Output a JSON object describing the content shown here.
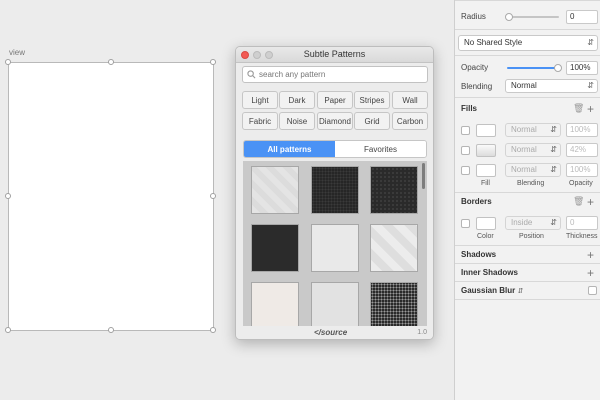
{
  "artboard": {
    "label": "view"
  },
  "plugin": {
    "title": "Subtle Patterns",
    "search_placeholder": "search any pattern",
    "chips": [
      "Light",
      "Dark",
      "Paper",
      "Stripes",
      "Wall",
      "Fabric",
      "Noise",
      "Diamond",
      "Grid",
      "Carbon"
    ],
    "tabs": {
      "all": "All patterns",
      "favorites": "Favorites"
    },
    "footer_logo": "source",
    "version": "1.0"
  },
  "inspector": {
    "radius": {
      "label": "Radius",
      "value": "0"
    },
    "shared_style": "No Shared Style",
    "opacity": {
      "label": "Opacity",
      "value": "100%",
      "level": 1.0
    },
    "blending": {
      "label": "Blending",
      "value": "Normal"
    },
    "fills": {
      "title": "Fills",
      "rows": [
        {
          "blend": "Normal",
          "opacity": "100%"
        },
        {
          "blend": "Normal",
          "opacity": "42%"
        },
        {
          "blend": "Normal",
          "opacity": "100%"
        }
      ],
      "col_fill": "Fill",
      "col_blending": "Blending",
      "col_opacity": "Opacity"
    },
    "borders": {
      "title": "Borders",
      "position": "Inside",
      "thickness": "0",
      "col_color": "Color",
      "col_position": "Position",
      "col_thickness": "Thickness"
    },
    "shadows": "Shadows",
    "inner_shadows": "Inner Shadows",
    "gaussian_blur": "Gaussian Blur"
  },
  "colors": {
    "accent": "#4a92f5"
  }
}
